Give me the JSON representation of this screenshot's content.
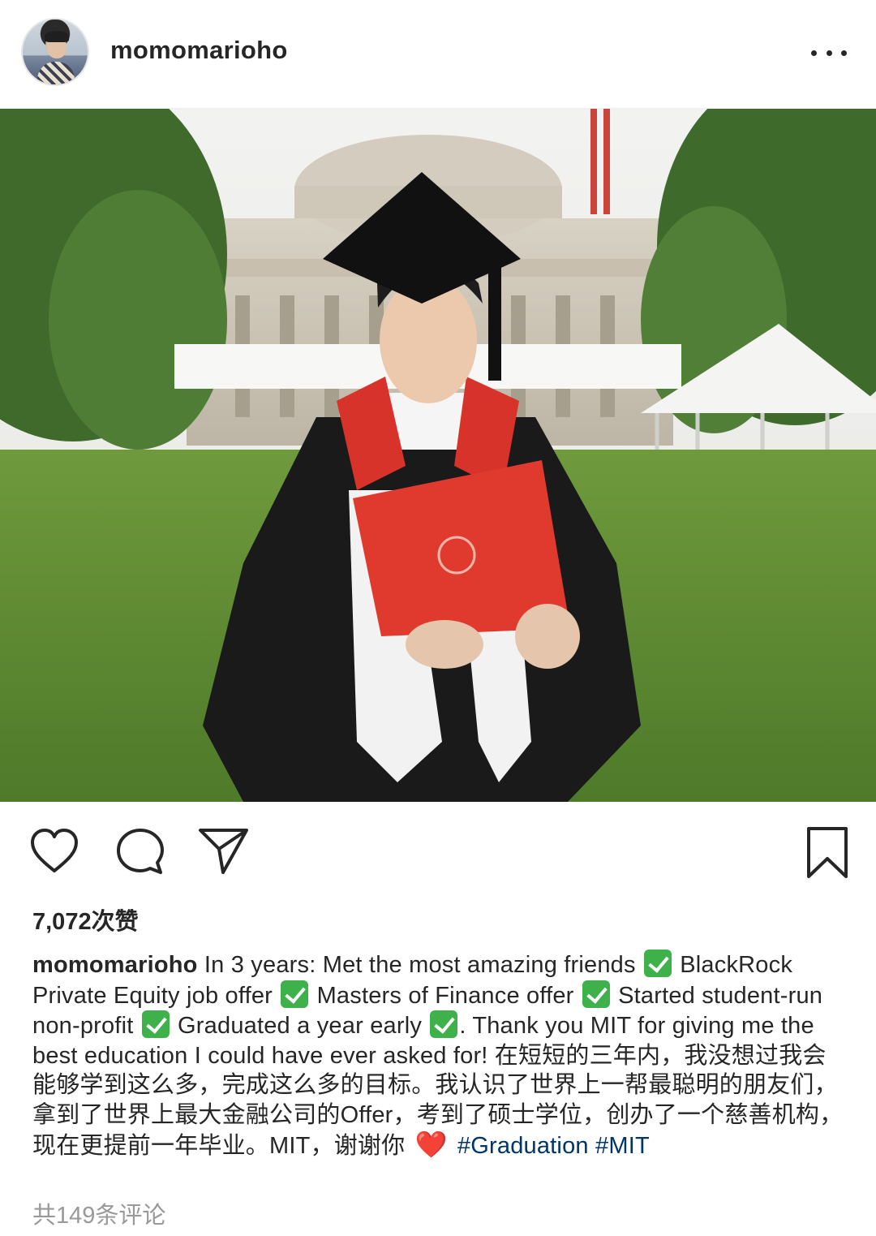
{
  "header": {
    "username": "momomarioho",
    "more_icon": "more-horizontal-icon"
  },
  "photo": {
    "description_icon": "post-photo"
  },
  "actions": {
    "like_icon": "heart-outline-icon",
    "comment_icon": "comment-bubble-icon",
    "share_icon": "paper-plane-icon",
    "save_icon": "bookmark-outline-icon"
  },
  "likes_text": "7,072次赞",
  "caption": {
    "username": "momomarioho",
    "segments": [
      "In 3 years: Met the most amazing friends",
      "BlackRock Private Equity job offer",
      "Masters of Finance offer",
      "Started student-run non-profit",
      "Graduated a year early",
      ". Thank you MIT for giving me the best education I could have ever asked for! 在短短的三年内，我没想过我会能够学到这么多，完成这么多的目标。我认识了世界上一帮最聪明的朋友们，拿到了世界上最大金融公司的Offer，考到了硕士学位，创办了一个慈善机构，现在更提前一年毕业。MIT，谢谢你",
      "#Graduation",
      "#MIT"
    ],
    "heart": "❤️"
  },
  "comments_link": "共149条评论",
  "colors": {
    "text": "#262626",
    "muted": "#999999",
    "hashtag": "#003569",
    "check": "#3fb14b",
    "heart": "#d9261c"
  }
}
